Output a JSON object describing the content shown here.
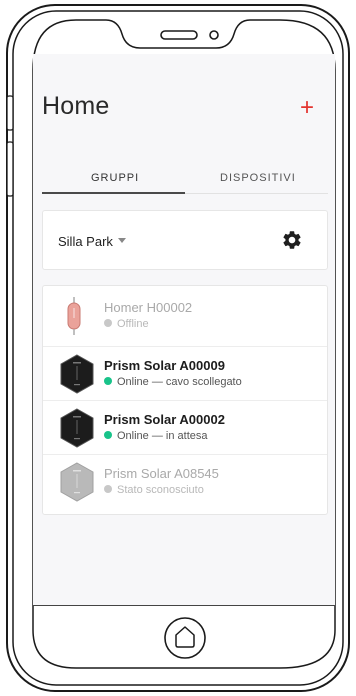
{
  "header": {
    "title": "Home",
    "add_label": "+"
  },
  "tabs": [
    {
      "label": "GRUPPI",
      "active": true
    },
    {
      "label": "DISPOSITIVI",
      "active": false
    }
  ],
  "group": {
    "name": "Silla Park"
  },
  "devices": [
    {
      "name": "Homer H00002",
      "status": "Offline",
      "status_color": "#c8c8c8",
      "icon": "homer-device-icon",
      "muted": true
    },
    {
      "name": "Prism Solar A00009",
      "status": "Online — cavo scollegato",
      "status_color": "#19c38a",
      "icon": "prism-device-icon",
      "muted": false
    },
    {
      "name": "Prism Solar A00002",
      "status": "Online — in attesa",
      "status_color": "#19c38a",
      "icon": "prism-device-icon",
      "muted": false
    },
    {
      "name": "Prism Solar A08545",
      "status": "Stato sconosciuto",
      "status_color": "#c8c8c8",
      "icon": "prism-device-icon",
      "muted": true
    }
  ],
  "colors": {
    "accent": "#e3342f",
    "online": "#19c38a",
    "unknown": "#c8c8c8"
  }
}
